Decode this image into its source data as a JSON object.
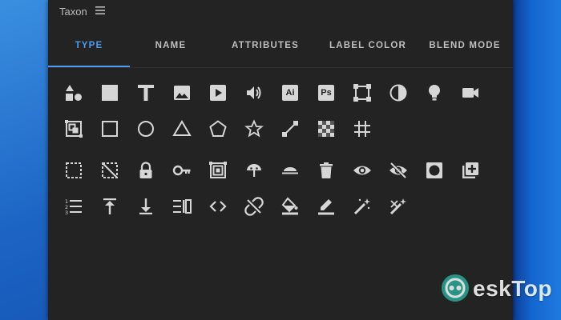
{
  "panel": {
    "title": "Taxon"
  },
  "tabs": [
    {
      "label": "TYPE",
      "active": true
    },
    {
      "label": "NAME",
      "active": false
    },
    {
      "label": "ATTRIBUTES",
      "active": false
    },
    {
      "label": "LABEL COLOR",
      "active": false
    },
    {
      "label": "BLEND MODE",
      "active": false
    }
  ],
  "type_icons": {
    "ai_label": "Ai",
    "ps_label": "Ps"
  },
  "colors": {
    "accent": "#4a9df0",
    "icon": "#d6d6d6",
    "panel_bg": "#232323"
  },
  "watermark": {
    "text": "eskTop"
  }
}
